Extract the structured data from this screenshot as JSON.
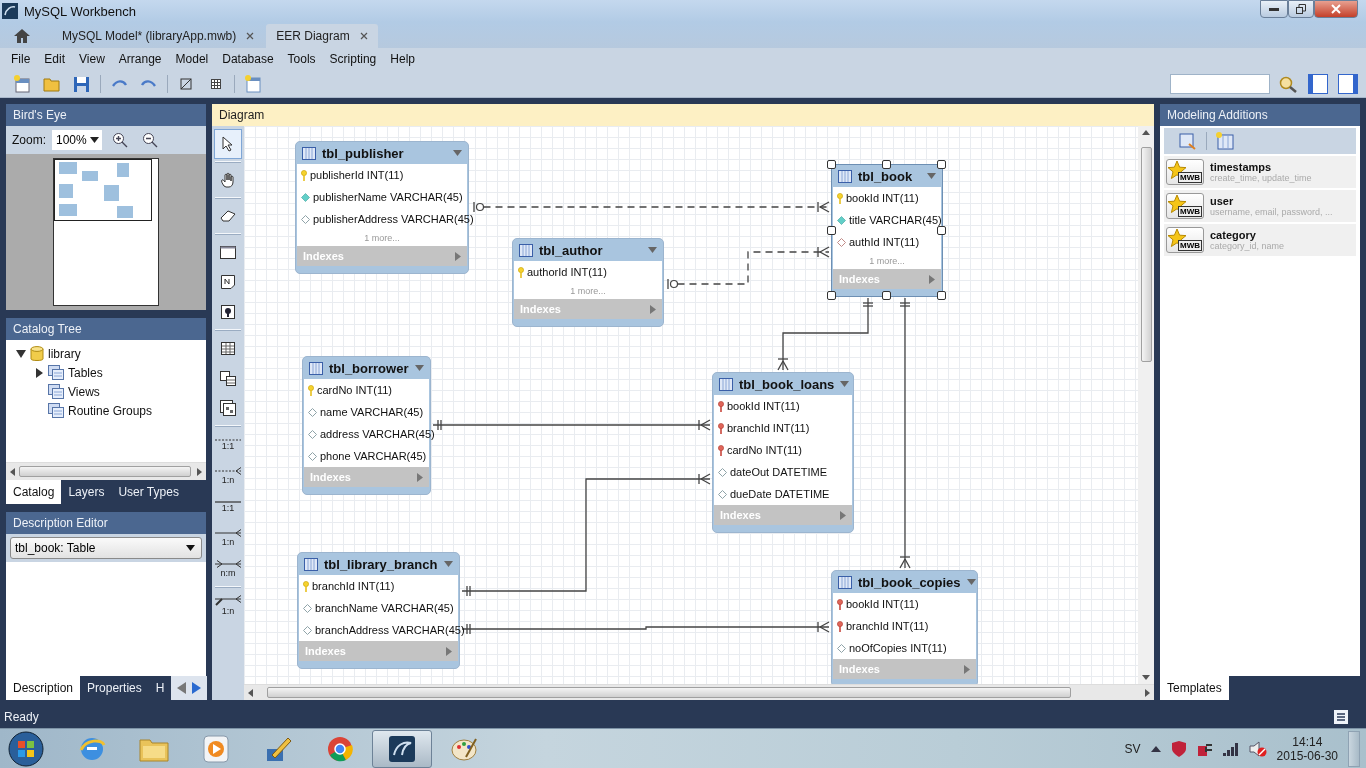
{
  "window": {
    "title": "MySQL Workbench"
  },
  "doc_tabs": [
    {
      "label": "MySQL Model* (libraryApp.mwb)",
      "selected": false
    },
    {
      "label": "EER Diagram",
      "selected": true
    }
  ],
  "menu": [
    "File",
    "Edit",
    "View",
    "Arrange",
    "Model",
    "Database",
    "Tools",
    "Scripting",
    "Help"
  ],
  "birds_eye": {
    "title": "Bird's Eye",
    "zoom_label": "Zoom:",
    "zoom_value": "100%"
  },
  "catalog": {
    "title": "Catalog Tree",
    "items": [
      {
        "label": "library",
        "expanded": true,
        "children": [
          {
            "label": "Tables",
            "expanded": false
          },
          {
            "label": "Views"
          },
          {
            "label": "Routine Groups"
          }
        ]
      }
    ],
    "tabs": [
      {
        "label": "Catalog",
        "selected": true
      },
      {
        "label": "Layers",
        "selected": false
      },
      {
        "label": "User Types",
        "selected": false
      }
    ]
  },
  "description_editor": {
    "title": "Description Editor",
    "select_value": "tbl_book: Table",
    "tabs": [
      {
        "label": "Description",
        "selected": true
      },
      {
        "label": "Properties",
        "selected": false
      },
      {
        "label": "H",
        "selected": false
      }
    ]
  },
  "diagram": {
    "title": "Diagram",
    "tools": [
      {
        "kind": "pointer",
        "selected": true
      },
      {
        "kind": "hand",
        "selected": false
      },
      {
        "kind": "eraser",
        "selected": false
      },
      {
        "kind": "layer",
        "selected": false
      },
      {
        "kind": "note",
        "selected": false
      },
      {
        "kind": "image",
        "selected": false
      },
      {
        "kind": "table",
        "selected": false
      },
      {
        "kind": "view",
        "selected": false
      },
      {
        "kind": "routine",
        "selected": false
      },
      {
        "kind": "dashedone",
        "label": "1:1",
        "selected": false
      },
      {
        "kind": "dashedmany",
        "label": "1:n",
        "selected": false
      },
      {
        "kind": "one",
        "label": "1:1",
        "selected": false
      },
      {
        "kind": "many",
        "label": "1:n",
        "selected": false
      },
      {
        "kind": "manymany",
        "label": "n:m",
        "selected": false
      },
      {
        "kind": "pickmany",
        "label": "1:n",
        "selected": false
      }
    ],
    "tables": [
      {
        "name": "tbl_publisher",
        "selected": false,
        "columns": [
          {
            "kind": "pk",
            "text": "publisherId INT(11)"
          },
          {
            "kind": "nn",
            "text": "publisherName VARCHAR(45)"
          },
          {
            "kind": "col",
            "text": "publisherAddress VARCHAR(45)"
          }
        ],
        "more": "1 more...",
        "indexes": "Indexes"
      },
      {
        "name": "tbl_author",
        "selected": false,
        "columns": [
          {
            "kind": "pk",
            "text": "authorId INT(11)"
          }
        ],
        "more": "1 more...",
        "indexes": "Indexes"
      },
      {
        "name": "tbl_book",
        "selected": true,
        "columns": [
          {
            "kind": "pk",
            "text": "bookId INT(11)"
          },
          {
            "kind": "nn",
            "text": "title VARCHAR(45)"
          },
          {
            "kind": "ref",
            "text": "authId INT(11)"
          }
        ],
        "more": "1 more...",
        "indexes": "Indexes"
      },
      {
        "name": "tbl_borrower",
        "selected": false,
        "columns": [
          {
            "kind": "pk",
            "text": "cardNo INT(11)"
          },
          {
            "kind": "col",
            "text": "name VARCHAR(45)"
          },
          {
            "kind": "col",
            "text": "address VARCHAR(45)"
          },
          {
            "kind": "col",
            "text": "phone VARCHAR(45)"
          }
        ],
        "indexes": "Indexes"
      },
      {
        "name": "tbl_book_loans",
        "selected": false,
        "columns": [
          {
            "kind": "fk",
            "text": "bookId INT(11)"
          },
          {
            "kind": "fk",
            "text": "branchId INT(11)"
          },
          {
            "kind": "fk",
            "text": "cardNo INT(11)"
          },
          {
            "kind": "col",
            "text": "dateOut DATETIME"
          },
          {
            "kind": "col",
            "text": "dueDate DATETIME"
          }
        ],
        "indexes": "Indexes"
      },
      {
        "name": "tbl_library_branch",
        "selected": false,
        "columns": [
          {
            "kind": "pk",
            "text": "branchId INT(11)"
          },
          {
            "kind": "col",
            "text": "branchName VARCHAR(45)"
          },
          {
            "kind": "col",
            "text": "branchAddress VARCHAR(45)"
          }
        ],
        "indexes": "Indexes"
      },
      {
        "name": "tbl_book_copies",
        "selected": false,
        "columns": [
          {
            "kind": "fk",
            "text": "bookId INT(11)"
          },
          {
            "kind": "fk",
            "text": "branchId INT(11)"
          },
          {
            "kind": "col",
            "text": "noOfCopies INT(11)"
          }
        ],
        "indexes": "Indexes"
      }
    ]
  },
  "modeling_additions": {
    "title": "Modeling Additions",
    "items": [
      {
        "name": "timestamps",
        "detail": "create_time, update_time",
        "badge": "MWB"
      },
      {
        "name": "user",
        "detail": "username, email, password, ...",
        "badge": "MWB"
      },
      {
        "name": "category",
        "detail": "category_id, name",
        "badge": "MWB"
      }
    ],
    "tabs": [
      {
        "label": "Templates",
        "selected": true
      }
    ]
  },
  "status_bar": {
    "text": "Ready"
  },
  "taskbar": {
    "apps": [
      {
        "kind": "browser",
        "active": false
      },
      {
        "kind": "folder",
        "active": false
      },
      {
        "kind": "media",
        "active": false
      },
      {
        "kind": "tool",
        "active": false
      },
      {
        "kind": "chrome",
        "active": false
      },
      {
        "kind": "workbench",
        "active": true
      },
      {
        "kind": "paint",
        "active": false
      }
    ],
    "language": "SV",
    "time": "14:14",
    "date": "2015-06-30"
  }
}
